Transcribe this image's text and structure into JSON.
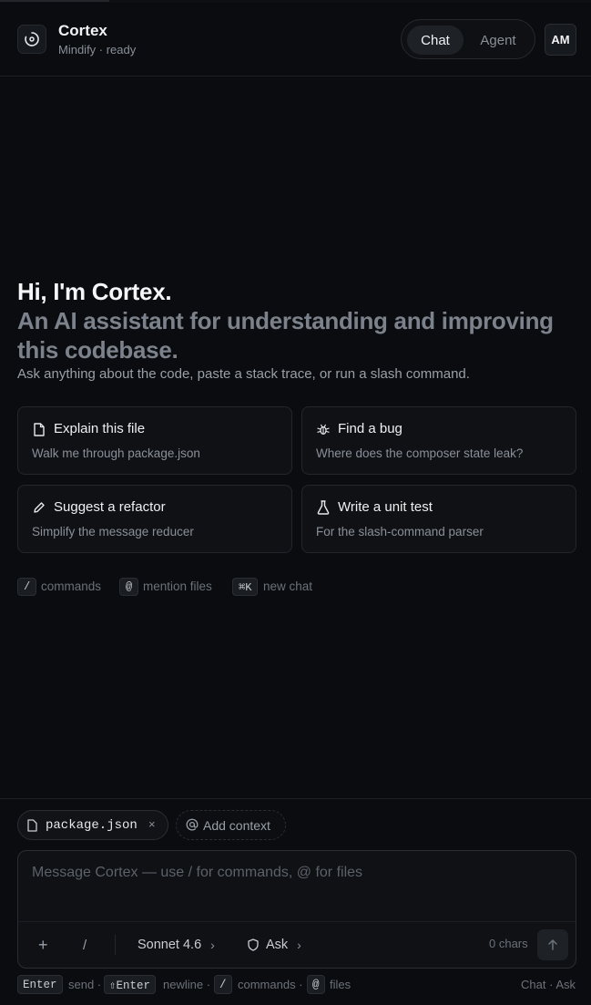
{
  "header": {
    "app_name": "Cortex",
    "subtitle": "Mindify · ready",
    "modes": [
      "Chat",
      "Agent"
    ],
    "active_mode": "Chat",
    "avatar_initials": "AM"
  },
  "hero": {
    "title": "Hi, I'm Cortex.",
    "tagline": "An AI assistant for understanding and improving this codebase.",
    "description": "Ask anything about the code, paste a stack trace, or run a slash command."
  },
  "suggestions": [
    {
      "icon": "file-icon",
      "title": "Explain this file",
      "description": "Walk me through package.json"
    },
    {
      "icon": "bug-icon",
      "title": "Find a bug",
      "description": "Where does the composer state leak?"
    },
    {
      "icon": "pencil-icon",
      "title": "Suggest a refactor",
      "description": "Simplify the message reducer"
    },
    {
      "icon": "flask-icon",
      "title": "Write a unit test",
      "description": "For the slash-command parser"
    }
  ],
  "hints": [
    {
      "key": "/",
      "label": "commands"
    },
    {
      "key": "@",
      "label": "mention files"
    },
    {
      "key": "⌘K",
      "label": "new chat"
    }
  ],
  "composer": {
    "context_chip": "package.json",
    "context_chip_close": "×",
    "add_context_label": "Add context",
    "placeholder": "Message Cortex — use / for commands, @ for files",
    "value": "",
    "plus_label": "+",
    "slash_label": "/",
    "model_label": "Sonnet 4.6",
    "permission_label": "Ask",
    "char_count": "0 chars"
  },
  "footer": {
    "keys": [
      {
        "key": "Enter",
        "label": "send ·"
      },
      {
        "key": "⇧Enter",
        "label": "newline ·"
      },
      {
        "key": "/",
        "label": "commands ·"
      },
      {
        "key": "@",
        "label": "files"
      }
    ],
    "mode_status": "Chat · Ask"
  },
  "colors": {
    "background": "#0a0c0f",
    "surface": "#0f1115",
    "border": "#23272c",
    "text_primary": "#f1f3f5",
    "text_muted": "#8a9099"
  }
}
